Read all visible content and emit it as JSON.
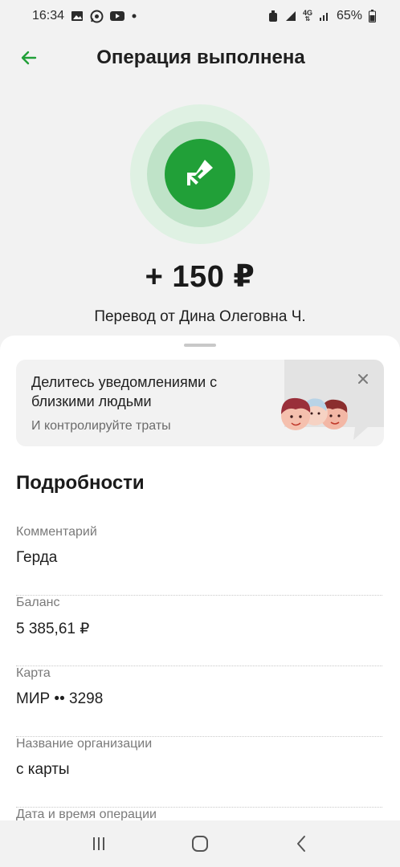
{
  "status_bar": {
    "time": "16:34",
    "battery": "65%",
    "network": "4G",
    "icons": [
      "image-icon",
      "whatsapp-icon",
      "youtube-icon",
      "dot-icon",
      "alarm-icon",
      "signal-icon",
      "network-4g-icon",
      "signal-icon",
      "battery-icon"
    ]
  },
  "header": {
    "title": "Операция выполнена",
    "back_icon": "arrow-left-icon"
  },
  "colors": {
    "accent": "#21a038",
    "ring_outer": "#dff1e3",
    "ring_mid": "#bfe3c8"
  },
  "success": {
    "icon": "transfer-arrow-icon",
    "amount": "+ 150 ₽",
    "description": "Перевод от Дина Олеговна Ч."
  },
  "promo": {
    "title": "Делитесь уведомлениями с близкими людьми",
    "subtitle": "И контролируйте траты",
    "close_icon": "close-icon"
  },
  "details": {
    "title": "Подробности",
    "items": [
      {
        "label": "Комментарий",
        "value": "Герда"
      },
      {
        "label": "Баланс",
        "value": "5 385,61 ₽"
      },
      {
        "label": "Карта",
        "value": "МИР •• 3298"
      },
      {
        "label": "Название организации",
        "value": "с карты"
      },
      {
        "label": "Дата и время операции",
        "value": ""
      }
    ]
  },
  "nav": {
    "items": [
      "recent-apps-icon",
      "home-icon",
      "back-icon"
    ]
  }
}
